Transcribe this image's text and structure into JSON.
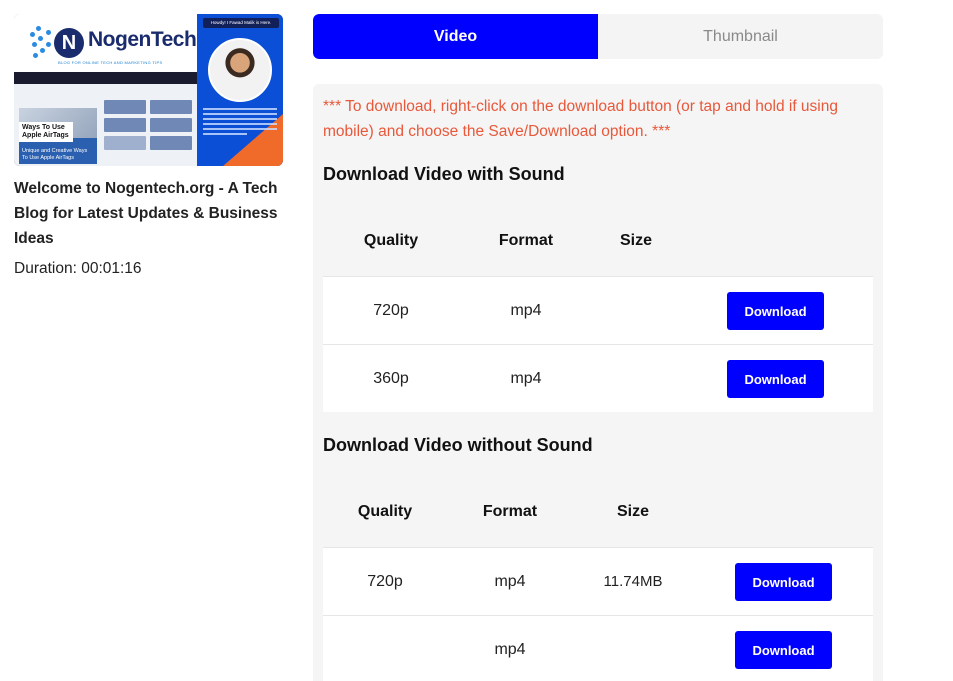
{
  "video": {
    "thumbnail": {
      "logo_text": "NogenTech",
      "logo_letter": "N",
      "logo_tagline": "BLOG FOR ONLINE TECH AND MARKETING TIPS",
      "card_label": "Ways To Use Apple AirTags",
      "card_subtitle": "Unique and Creative Ways To Use Apple AirTags",
      "author_bubble": "Howdy! I Fawad Malik is Here."
    },
    "title": "Welcome to Nogentech.org - A Tech Blog for Latest Updates & Business Ideas",
    "duration": "Duration: 00:01:16"
  },
  "tabs": [
    {
      "label": "Video",
      "active": true
    },
    {
      "label": "Thumbnail",
      "active": false
    }
  ],
  "notice": "*** To download, right-click on the download button (or tap and hold if using mobile) and choose the Save/Download option. ***",
  "with_sound": {
    "title": "Download Video with Sound",
    "headers": {
      "quality": "Quality",
      "format": "Format",
      "size": "Size"
    },
    "rows": [
      {
        "quality": "720p",
        "format": "mp4",
        "size": "",
        "button": "Download"
      },
      {
        "quality": "360p",
        "format": "mp4",
        "size": "",
        "button": "Download"
      }
    ]
  },
  "without_sound": {
    "title": "Download Video without Sound",
    "headers": {
      "quality": "Quality",
      "format": "Format",
      "size": "Size"
    },
    "rows": [
      {
        "quality": "720p",
        "format": "mp4",
        "size": "11.74MB",
        "button": "Download"
      },
      {
        "quality": "",
        "format": "mp4",
        "size": "",
        "button": "Download"
      }
    ]
  },
  "colors": {
    "accent": "#0000ff",
    "notice": "#e8583a",
    "panel_bg": "#f5f5f5"
  }
}
